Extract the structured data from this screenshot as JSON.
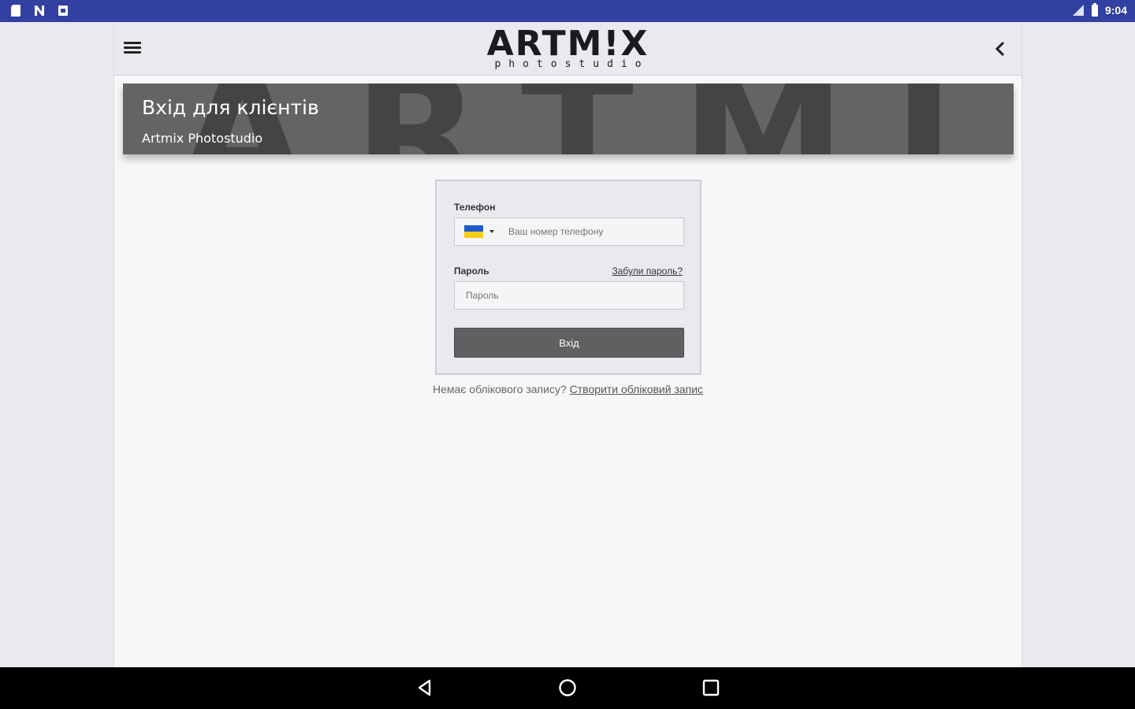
{
  "status_bar": {
    "time": "9:04",
    "left_icons": [
      "sd-card-icon",
      "n-icon",
      "download-icon"
    ],
    "right_icons": [
      "signal-icon",
      "battery-icon"
    ],
    "color": "#3240a1"
  },
  "topbar": {
    "logo_main": "ARTM!X",
    "logo_sub": "photostudio"
  },
  "banner": {
    "title": "Вхід для клієнтів",
    "subtitle": "Artmix Photostudio",
    "background_text": "ARTMIX"
  },
  "form": {
    "phone_label": "Телефон",
    "phone_placeholder": "Ваш номер телефону",
    "country_flag": "Ukraine",
    "password_label": "Пароль",
    "forgot_link": "Забули пароль?",
    "password_placeholder": "Пароль",
    "submit_label": "Вхід"
  },
  "signup": {
    "prompt": "Немає облікового запису?",
    "link": "Створити обліковий запис"
  },
  "navbar": {
    "buttons": [
      "back-icon",
      "home-icon",
      "recents-icon"
    ]
  }
}
